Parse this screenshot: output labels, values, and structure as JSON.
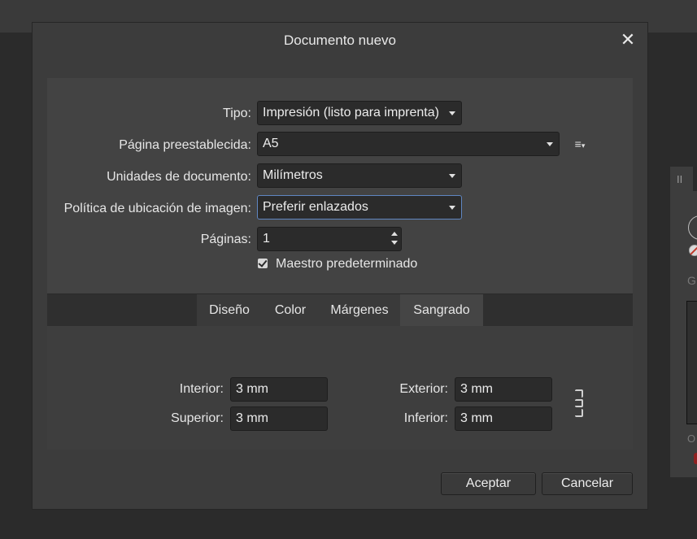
{
  "dialog": {
    "title": "Documento nuevo",
    "close_glyph": "✕"
  },
  "form": {
    "tipo_label": "Tipo:",
    "tipo_value": "Impresión (listo para imprenta)",
    "pagina_label": "Página preestablecida:",
    "pagina_value": "A5",
    "preset_menu_glyph": "≡",
    "unidades_label": "Unidades de documento:",
    "unidades_value": "Milímetros",
    "politica_label": "Política de ubicación de imagen:",
    "politica_value": "Preferir enlazados",
    "paginas_label": "Páginas:",
    "paginas_value": "1",
    "maestro_label": "Maestro predeterminado",
    "maestro_checked": true
  },
  "tabs": [
    {
      "label": "Diseño"
    },
    {
      "label": "Color"
    },
    {
      "label": "Márgenes"
    },
    {
      "label": "Sangrado",
      "active": true
    }
  ],
  "bleed": {
    "interior_label": "Interior:",
    "interior_value": "3 mm",
    "superior_label": "Superior:",
    "superior_value": "3 mm",
    "exterior_label": "Exterior:",
    "exterior_value": "3 mm",
    "inferior_label": "Inferior:",
    "inferior_value": "3 mm"
  },
  "footer": {
    "accept_label": "Aceptar",
    "cancel_label": "Cancelar"
  },
  "background_panel": {
    "grip_glyph": "II",
    "letter_g": "G",
    "letter_o": "O"
  },
  "colors": {
    "accent_focus": "#5f86c2",
    "dialog_bg": "#3c3c3c",
    "field_bg": "#2b2b2b"
  }
}
